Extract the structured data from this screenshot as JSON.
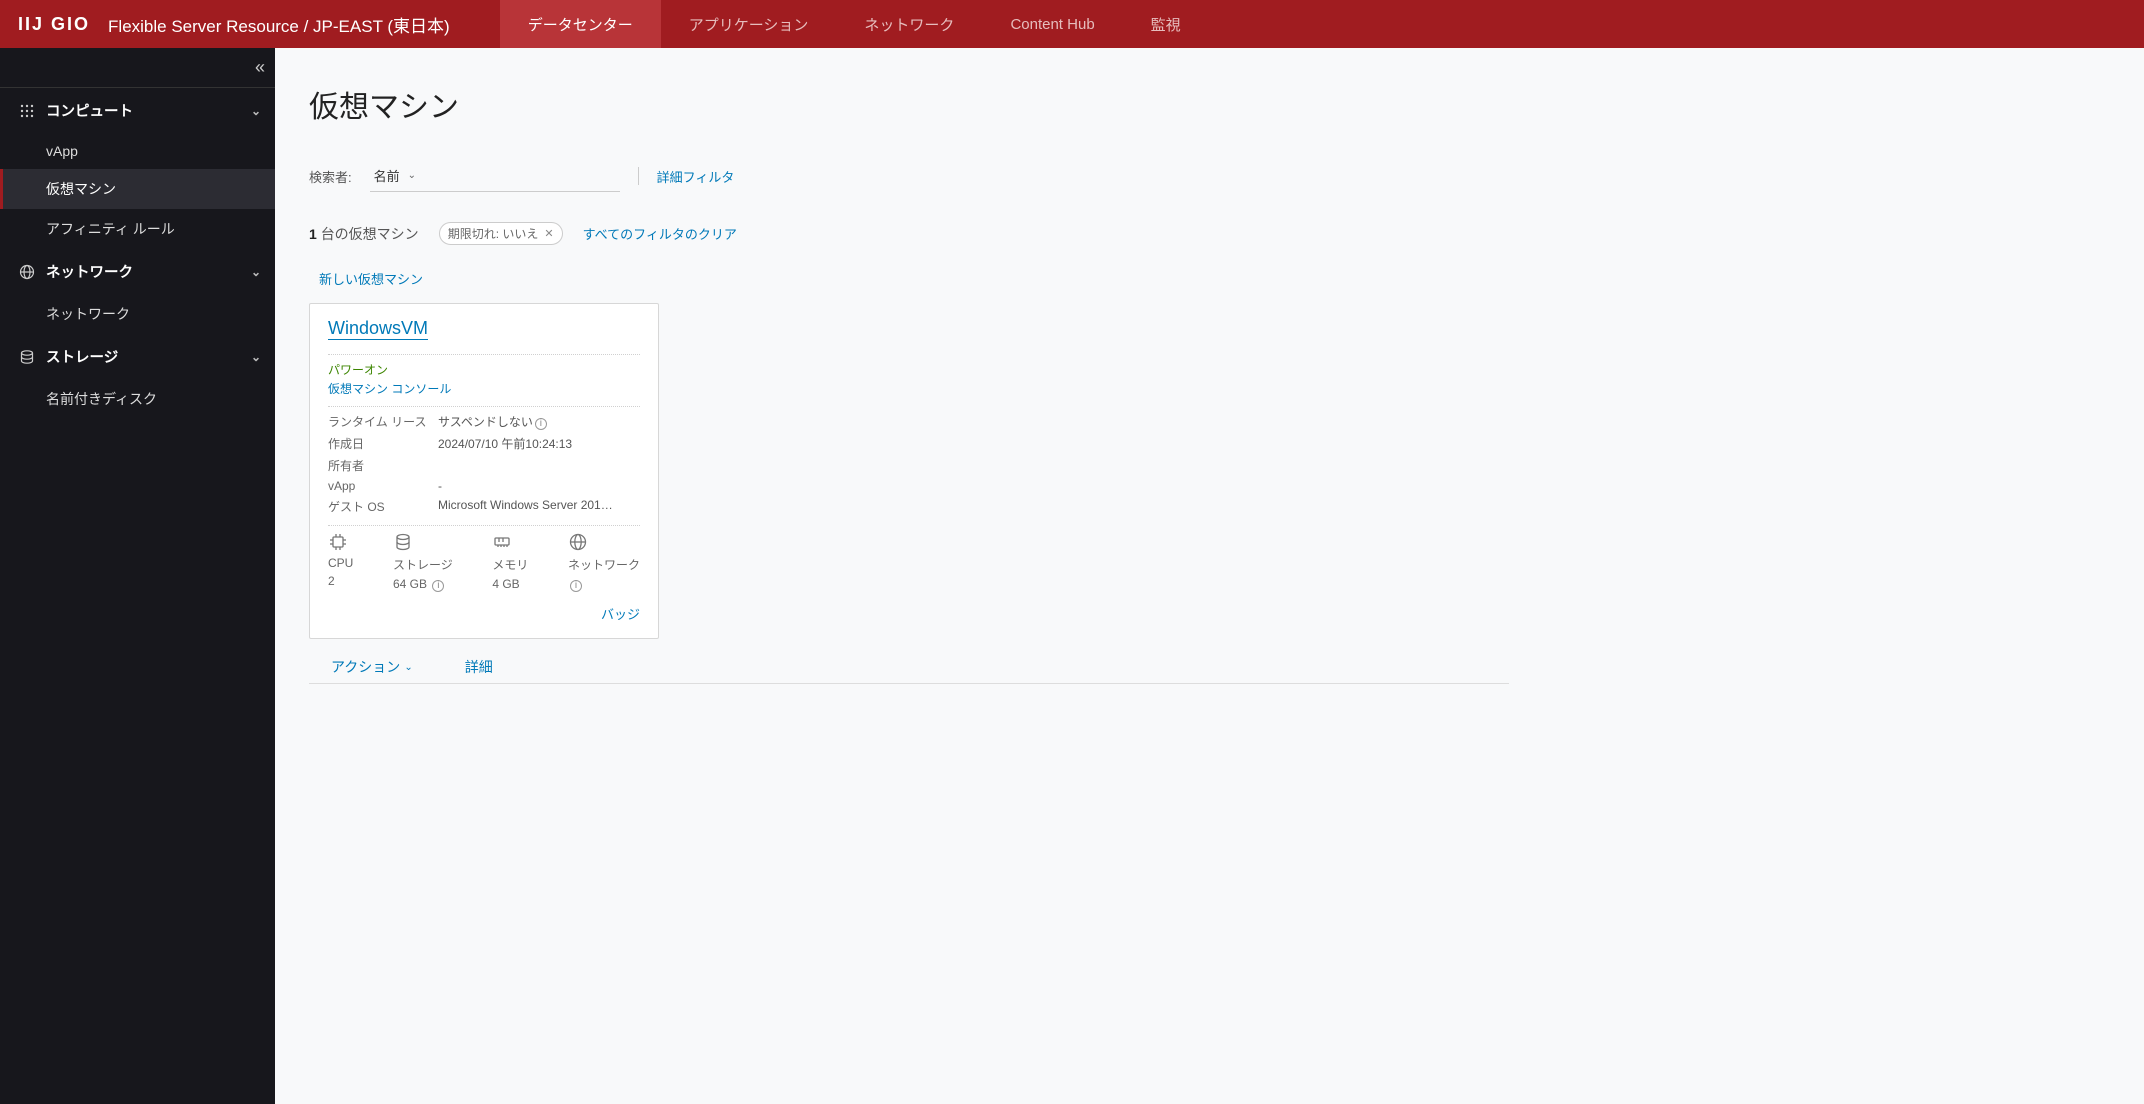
{
  "header": {
    "logo_text": "IIJ GIO",
    "app_title": "Flexible Server Resource / JP-EAST (東日本)",
    "tabs": [
      "データセンター",
      "アプリケーション",
      "ネットワーク",
      "Content Hub",
      "監視"
    ]
  },
  "sidebar": {
    "sections": [
      {
        "label": "コンピュート",
        "items": [
          "vApp",
          "仮想マシン",
          "アフィニティ ルール"
        ]
      },
      {
        "label": "ネットワーク",
        "items": [
          "ネットワーク"
        ]
      },
      {
        "label": "ストレージ",
        "items": [
          "名前付きディスク"
        ]
      }
    ]
  },
  "page": {
    "title": "仮想マシン",
    "search_label": "検索者:",
    "search_criteria": "名前",
    "advanced_filter": "詳細フィルタ",
    "count_prefix": "1",
    "count_text": "台の仮想マシン",
    "chip_label": "期限切れ: いいえ",
    "clear_filters": "すべてのフィルタのクリア",
    "new_button": "新しい仮想マシン"
  },
  "vm": {
    "name": "WindowsVM",
    "status": "パワーオン",
    "console": "仮想マシン コンソール",
    "runtime_label": "ランタイム リース",
    "runtime_value": "サスペンドしない",
    "created_label": "作成日",
    "created_value": "2024/07/10 午前10:24:13",
    "owner_label": "所有者",
    "owner_value": "",
    "vapp_label": "vApp",
    "vapp_value": "-",
    "os_label": "ゲスト OS",
    "os_value": "Microsoft Windows Server 201…",
    "cpu_label": "CPU",
    "cpu_value": "2",
    "storage_label": "ストレージ",
    "storage_value": "64 GB",
    "memory_label": "メモリ",
    "memory_value": "4 GB",
    "network_label": "ネットワーク",
    "network_value": "",
    "badge_label": "バッジ",
    "action_label": "アクション",
    "detail_label": "詳細"
  }
}
